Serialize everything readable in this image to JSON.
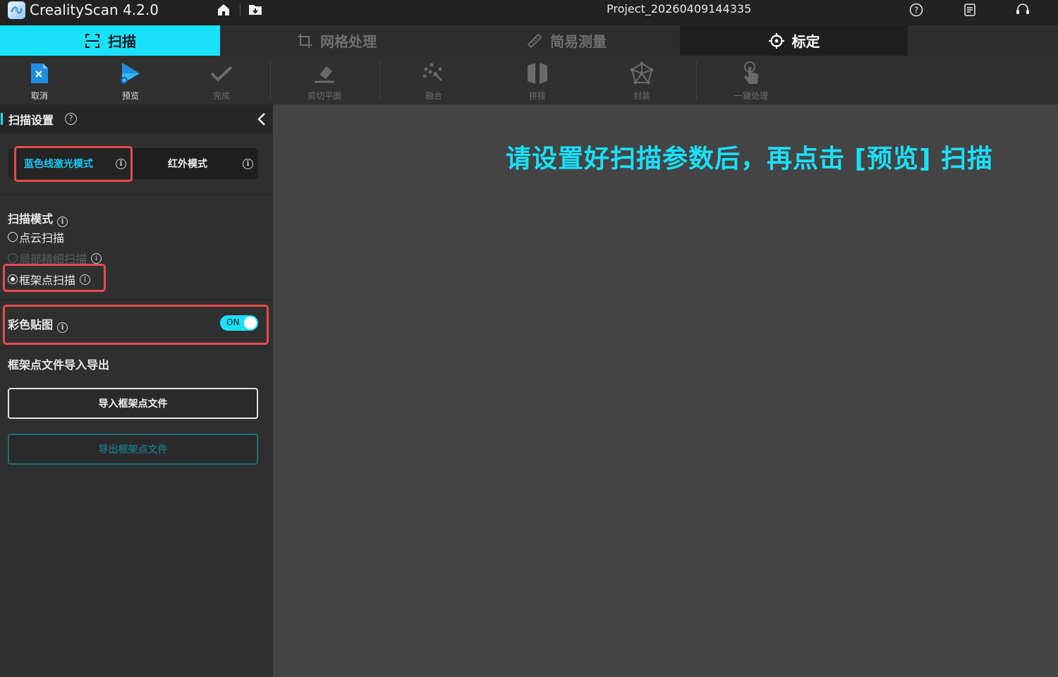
{
  "app": {
    "title": "CrealityScan 4.2.0",
    "project_name": "Project_20260409144335"
  },
  "tabs": [
    {
      "label": "扫描",
      "icon": "scan-frame-icon",
      "state": "active"
    },
    {
      "label": "网格处理",
      "icon": "crop-icon",
      "state": "disabled"
    },
    {
      "label": "简易测量",
      "icon": "ruler-icon",
      "state": "disabled"
    },
    {
      "label": "标定",
      "icon": "crosshair-icon",
      "state": "selected"
    }
  ],
  "toolbar": {
    "cancel": "取消",
    "preview": "预览",
    "done": "完成",
    "cut_plane": "剪切平面",
    "fuse": "融合",
    "stitch": "拼接",
    "encapsulate": "封装",
    "one_click": "一键处理"
  },
  "panel": {
    "title": "扫描设置",
    "help": "?",
    "modes": {
      "blue_laser": "蓝色线激光模式",
      "infrared": "红外模式",
      "selected": "blue_laser"
    },
    "scan_mode": {
      "title": "扫描模式",
      "options": [
        {
          "label": "点云扫描",
          "checked": false,
          "enabled": true
        },
        {
          "label": "局部精细扫描",
          "checked": false,
          "enabled": false
        },
        {
          "label": "框架点扫描",
          "checked": true,
          "enabled": true
        }
      ]
    },
    "color_texture": {
      "label": "彩色贴图",
      "toggle_label": "ON",
      "enabled": true
    },
    "frame_points": {
      "title": "框架点文件导入导出",
      "import_label": "导入框架点文件",
      "export_label": "导出框架点文件"
    }
  },
  "viewport": {
    "hint": "请设置好扫描参数后，再点击 [预览] 扫描"
  },
  "colors": {
    "accent": "#19e0fb",
    "highlight": "#e84a4a"
  }
}
